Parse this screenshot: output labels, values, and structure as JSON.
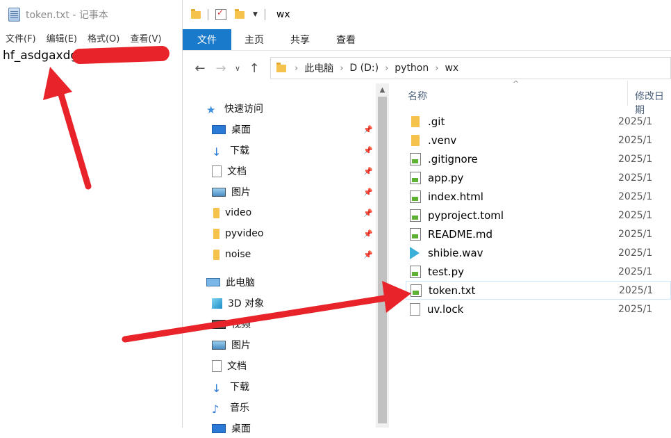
{
  "notepad": {
    "title": "token.txt - 记事本",
    "menu": [
      "文件(F)",
      "编辑(E)",
      "格式(O)",
      "查看(V)"
    ],
    "content": "hf_asdgaxdgasdg"
  },
  "explorer": {
    "window_title": "wx",
    "ribbon_tabs": [
      "文件",
      "主页",
      "共享",
      "查看"
    ],
    "breadcrumb": [
      "此电脑",
      "D (D:)",
      "python",
      "wx"
    ],
    "nav": {
      "quick_access": "快速访问",
      "pinned": [
        "桌面",
        "下载",
        "文档",
        "图片",
        "video",
        "pyvideo",
        "noise"
      ],
      "this_pc": "此电脑",
      "pc_items": [
        "3D 对象",
        "视频",
        "图片",
        "文档",
        "下载",
        "音乐",
        "桌面"
      ]
    },
    "columns": {
      "name": "名称",
      "modified": "修改日期"
    },
    "files": [
      {
        "name": ".git",
        "date": "2025/1",
        "icon": "folder-icon"
      },
      {
        "name": ".venv",
        "date": "2025/1",
        "icon": "folder-icon"
      },
      {
        "name": ".gitignore",
        "date": "2025/1",
        "icon": "notepad-file-icon"
      },
      {
        "name": "app.py",
        "date": "2025/1",
        "icon": "notepad-file-icon"
      },
      {
        "name": "index.html",
        "date": "2025/1",
        "icon": "notepad-file-icon"
      },
      {
        "name": "pyproject.toml",
        "date": "2025/1",
        "icon": "notepad-file-icon"
      },
      {
        "name": "README.md",
        "date": "2025/1",
        "icon": "notepad-file-icon"
      },
      {
        "name": "shibie.wav",
        "date": "2025/1",
        "icon": "media-file-icon"
      },
      {
        "name": "test.py",
        "date": "2025/1",
        "icon": "notepad-file-icon"
      },
      {
        "name": "token.txt",
        "date": "2025/1",
        "icon": "notepad-file-icon"
      },
      {
        "name": "uv.lock",
        "date": "2025/1",
        "icon": "blank-file-icon"
      }
    ],
    "selected_file": "token.txt"
  },
  "annotation_color": "#e8232a"
}
